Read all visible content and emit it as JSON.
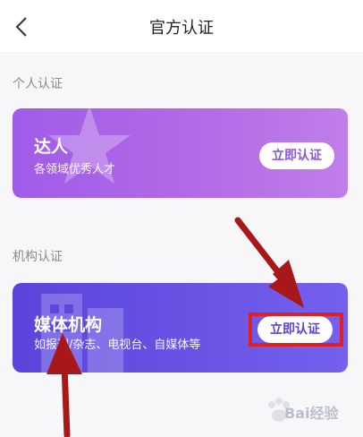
{
  "nav": {
    "title": "官方认证",
    "back_icon": "chevron-left-icon"
  },
  "sections": [
    {
      "title": "个人认证",
      "card": {
        "name": "达人",
        "desc": "各领域优秀人才",
        "button": "立即认证",
        "gradient": [
          "#a05ce8",
          "#c07ee8"
        ],
        "icon": "star-icon"
      }
    },
    {
      "title": "机构认证",
      "card": {
        "name": "媒体机构",
        "desc": "如报刊/杂志、电视台、自媒体等",
        "button": "立即认证",
        "gradient": [
          "#5a44dc",
          "#7560ee"
        ],
        "icon": "building-icon"
      }
    }
  ],
  "annotation": {
    "highlight_color": "#e02020",
    "arrow_color": "#a81818"
  },
  "watermark": {
    "text": "Bai经验"
  }
}
